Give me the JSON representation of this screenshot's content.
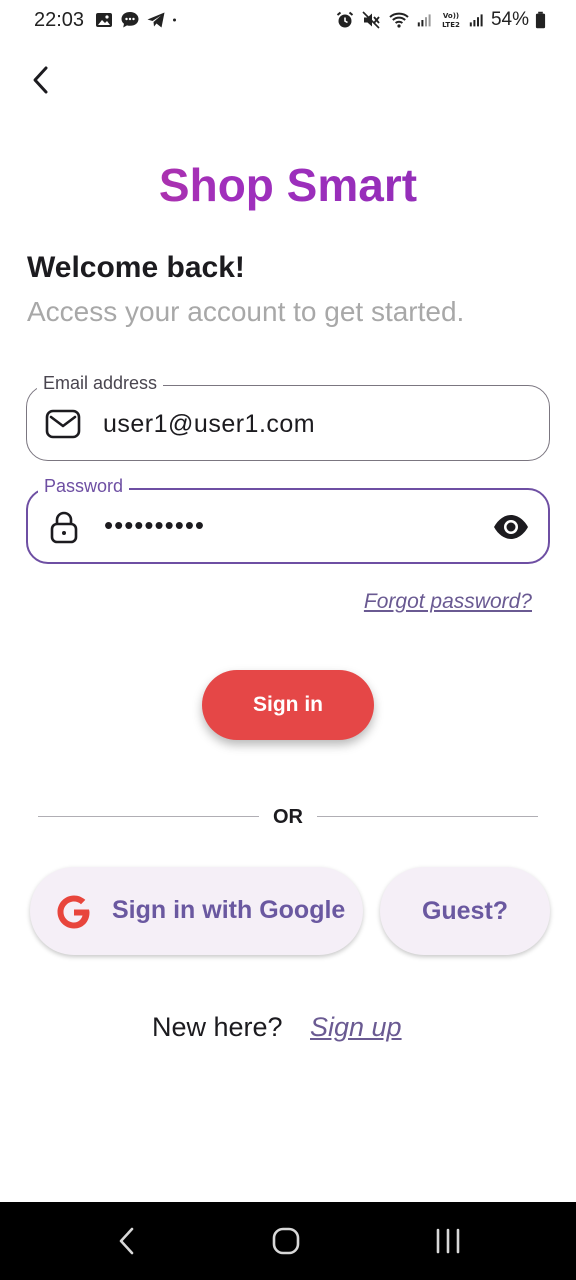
{
  "status_bar": {
    "time": "22:03",
    "battery": "54%",
    "left_icons": [
      "gallery-icon",
      "message-icon",
      "telegram-icon",
      "dot-icon"
    ],
    "right_icons": [
      "alarm-icon",
      "mute-icon",
      "wifi-icon",
      "signal-icon",
      "volte-icon",
      "signal-icon",
      "battery-icon"
    ]
  },
  "header": {
    "back_icon": "chevron-left-icon",
    "brand": "Shop Smart"
  },
  "intro": {
    "title": "Welcome back!",
    "subtitle": "Access your account to get started."
  },
  "form": {
    "email": {
      "label": "Email address",
      "value": "user1@user1.com",
      "icon": "mail-icon"
    },
    "password": {
      "label": "Password",
      "value": "••••••••••",
      "icon": "lock-icon",
      "toggle_icon": "eye-icon"
    },
    "forgot": "Forgot password?",
    "submit": "Sign in"
  },
  "divider": {
    "text": "OR"
  },
  "social": {
    "google": "Sign in with Google",
    "guest": "Guest?"
  },
  "footer": {
    "prompt": "New here?",
    "link": "Sign up"
  },
  "colors": {
    "accent": "#6e4fa3",
    "primary_button": "#e54747",
    "brand_gradient_start": "#c2378f",
    "brand_gradient_end": "#8a2db5"
  }
}
